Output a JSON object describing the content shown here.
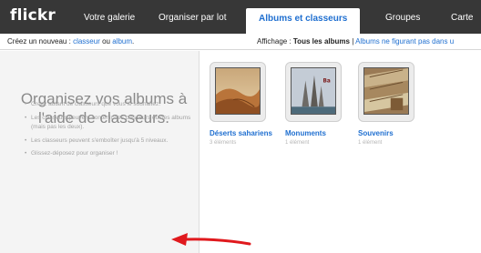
{
  "brand": {
    "logo": "flickr"
  },
  "nav": {
    "tabs": [
      {
        "label": "Votre galerie"
      },
      {
        "label": "Organiser par lot"
      },
      {
        "label": "Albums et classeurs",
        "active": true
      },
      {
        "label": "Groupes"
      },
      {
        "label": "Carte"
      }
    ]
  },
  "subbar": {
    "create_prefix": "Créez un nouveau :",
    "create_folder": "classeur",
    "create_or": "ou",
    "create_album": "album",
    "create_suffix": ".",
    "display_prefix": "Affichage :",
    "display_all": "Tous les albums",
    "separator": "|",
    "display_other": "Albums ne figurant pas dans u"
  },
  "leftpanel": {
    "headline": "Organisez vos albums à l'aide de classeurs.",
    "tips": [
      "Créez autant de classeurs que vous le souhaitez.",
      "Les classeurs peuvent contenir des classeurs ou des albums (mais pas les deux).",
      "Les classeurs peuvent s'emboîter jusqu'à 5 niveaux.",
      "Glissez-déposez pour organiser !"
    ]
  },
  "albums": [
    {
      "title": "Déserts sahariens",
      "count": "3 éléments",
      "icon": "desert-photo"
    },
    {
      "title": "Monuments",
      "count": "1 élément",
      "icon": "temple-photo"
    },
    {
      "title": "Souvenirs",
      "count": "1 élément",
      "icon": "market-photo"
    }
  ],
  "colors": {
    "topbar": "#373737",
    "link": "#1f6fd0",
    "annotation_arrow": "#e0191d"
  }
}
